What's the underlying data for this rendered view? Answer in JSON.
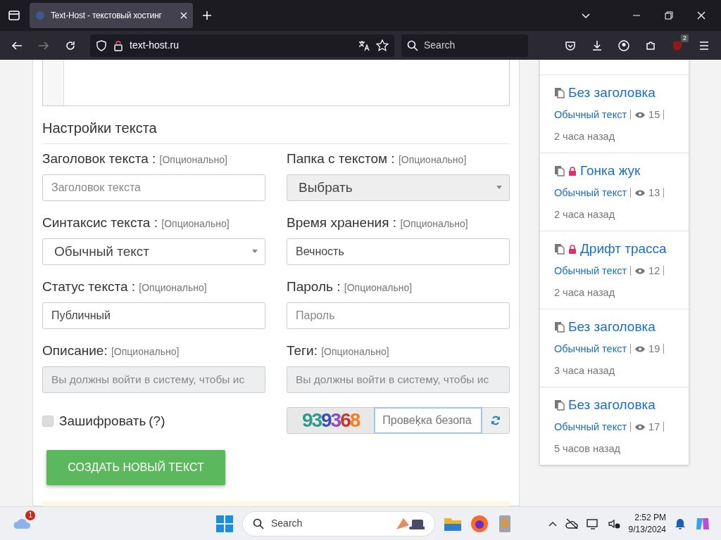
{
  "browser": {
    "tab_title": "Text-Host - текстовый хостинг",
    "url": "text-host.ru",
    "search_placeholder": "Search",
    "extensions_badge": "2"
  },
  "form": {
    "section_title": "Настройки текста",
    "fields": [
      {
        "label": "Заголовок текста :",
        "hint": "[Опционально]",
        "kind": "input",
        "placeholder": "Заголовок текста"
      },
      {
        "label": "Папка с текстом :",
        "hint": "[Опционально]",
        "kind": "select2",
        "value": "Выбрать",
        "disabled": true
      },
      {
        "label": "Синтаксис текста :",
        "hint": "[Опционально]",
        "kind": "select2",
        "value": "Обычный текст",
        "disabled": false
      },
      {
        "label": "Время хранения :",
        "hint": "[Опционально]",
        "kind": "select",
        "value": "Вечность"
      },
      {
        "label": "Статус текста :",
        "hint": "[Опционально]",
        "kind": "select",
        "value": "Публичный"
      },
      {
        "label": "Пароль :",
        "hint": "[Опционально]",
        "kind": "input",
        "placeholder": "Пароль"
      },
      {
        "label": "Описание:",
        "hint": "[Опционально]",
        "kind": "readonly",
        "placeholder": "Вы должны войти в систему, чтобы ис"
      },
      {
        "label": "Теги:",
        "hint": "[Опционально]",
        "kind": "readonly",
        "placeholder": "Вы должны войти в систему, чтобы ис"
      }
    ],
    "encrypt": {
      "label": "Зашифровать",
      "help": "(?)",
      "checked": false
    },
    "captcha": {
      "code": "939368",
      "placeholder": "Провеķка безопа"
    },
    "submit_button": "СОЗДАТЬ НОВЫЙ ТЕКСТ"
  },
  "sidebar": {
    "items": [
      {
        "title": "Без заголовка",
        "locked": false,
        "syntax": "Обычный текст",
        "views": "15",
        "time": "2 часа назад"
      },
      {
        "title": "Гонка жук",
        "locked": true,
        "syntax": "Обычный текст",
        "views": "13",
        "time": "2 часа назад"
      },
      {
        "title": "Дрифт трасса",
        "locked": true,
        "syntax": "Обычный текст",
        "views": "12",
        "time": "2 часа назад"
      },
      {
        "title": "Без заголовка",
        "locked": false,
        "syntax": "Обычный текст",
        "views": "19",
        "time": "3 часа назад"
      },
      {
        "title": "Без заголовка",
        "locked": false,
        "syntax": "Обычный текст",
        "views": "17",
        "time": "5 часов назад"
      }
    ]
  },
  "taskbar": {
    "weather_badge": "1",
    "search_placeholder": "Search",
    "time": "2:52 PM",
    "date": "9/13/2024"
  }
}
